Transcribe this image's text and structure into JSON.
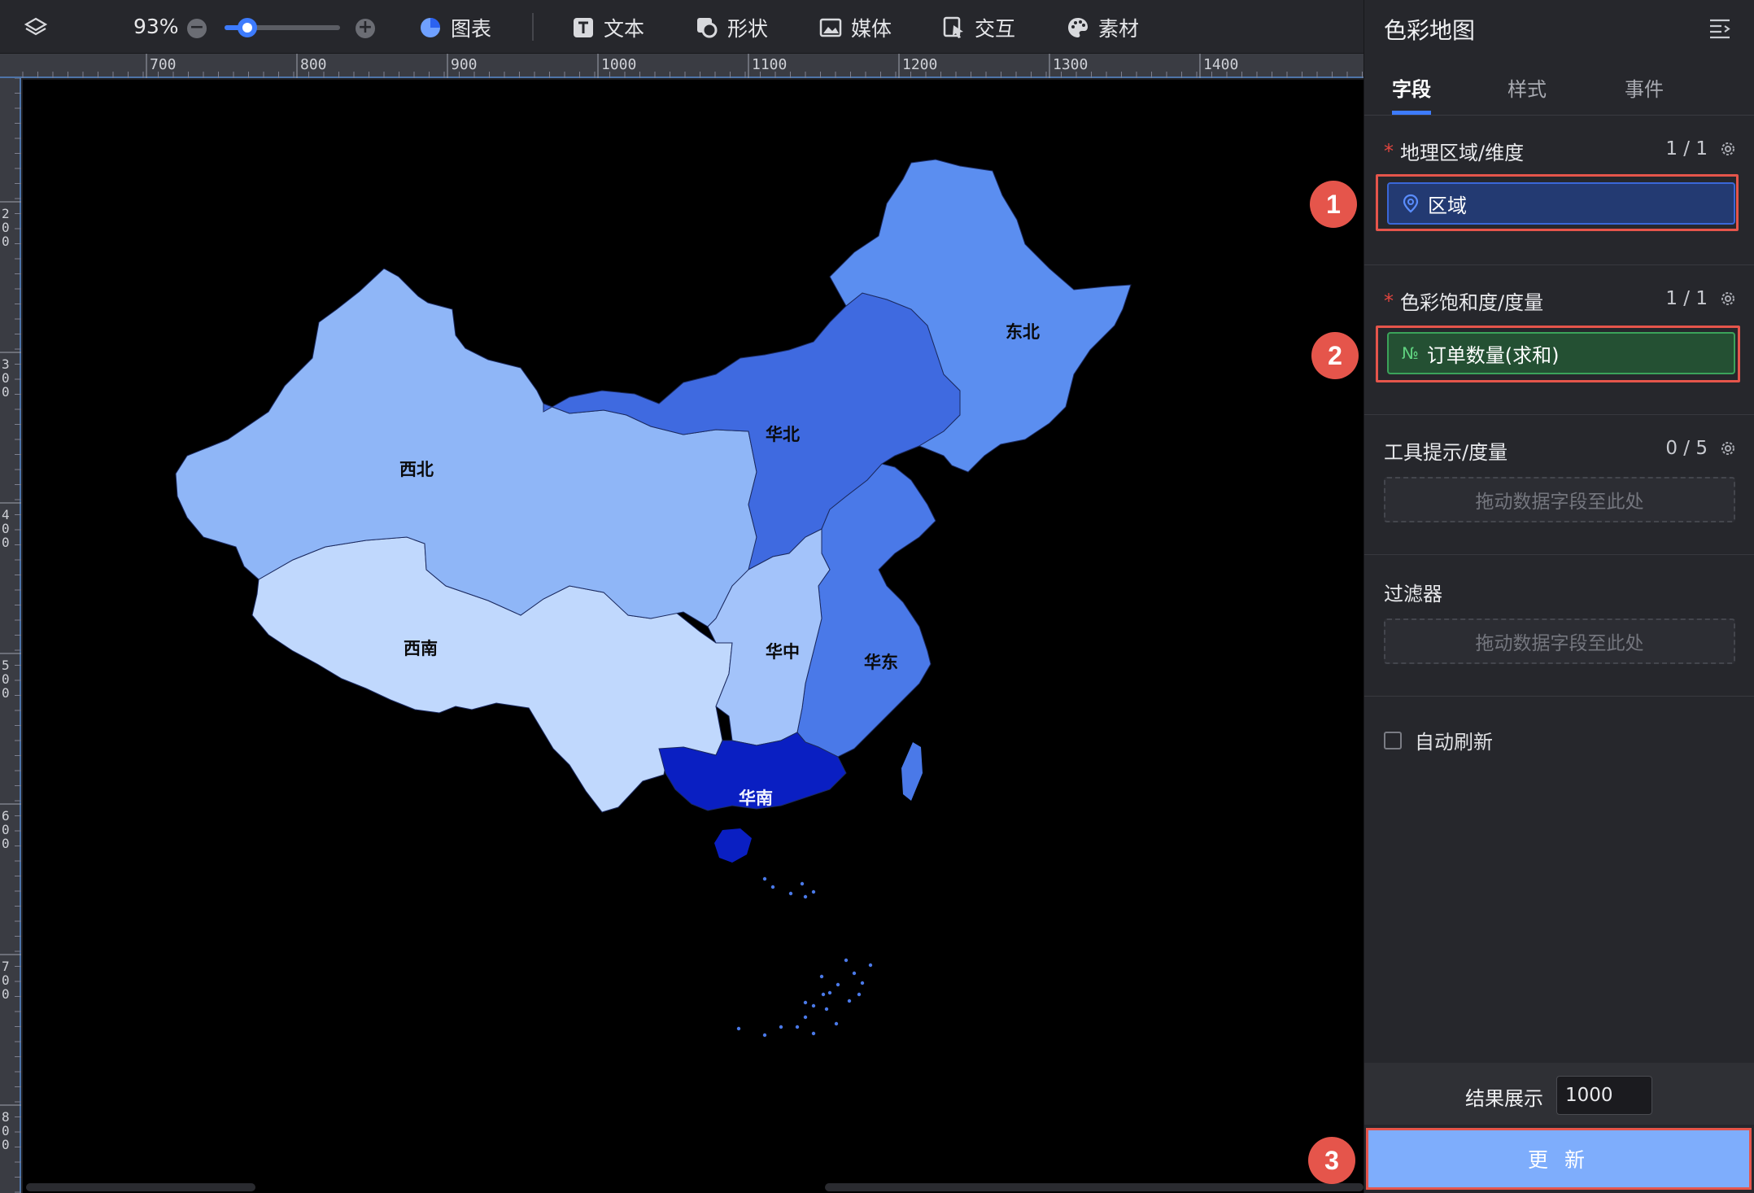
{
  "toolbar": {
    "zoom": "93%",
    "zoom_fraction": 0.2,
    "items": [
      {
        "label": "图表",
        "icon": "pie-chart-icon"
      },
      {
        "label": "文本",
        "icon": "text-icon"
      },
      {
        "label": "形状",
        "icon": "shape-icon"
      },
      {
        "label": "媒体",
        "icon": "image-icon"
      },
      {
        "label": "交互",
        "icon": "interaction-icon"
      },
      {
        "label": "素材",
        "icon": "palette-icon"
      }
    ]
  },
  "ruler": {
    "top_labels": [
      "700",
      "800",
      "900",
      "1000",
      "1100",
      "1200",
      "1300",
      "1400"
    ],
    "left_labels": [
      "200",
      "300",
      "400",
      "500",
      "600",
      "700",
      "800"
    ]
  },
  "map": {
    "regions": [
      {
        "name": "东北",
        "color": "#5b8ef0"
      },
      {
        "name": "华北",
        "color": "#3f6ae0"
      },
      {
        "name": "西北",
        "color": "#8fb6f7"
      },
      {
        "name": "西南",
        "color": "#c0d8fd"
      },
      {
        "name": "华中",
        "color": "#a3c3fa"
      },
      {
        "name": "华东",
        "color": "#4a79e8"
      },
      {
        "name": "华南",
        "color": "#0a1fc2"
      }
    ]
  },
  "panel": {
    "title": "色彩地图",
    "tabs": [
      "字段",
      "样式",
      "事件"
    ],
    "active_tab": "字段",
    "geo": {
      "label": "地理区域/维度",
      "count": "1 / 1",
      "field": "区域"
    },
    "color_measure": {
      "label": "色彩饱和度/度量",
      "count": "1 / 1",
      "field_prefix": "№",
      "field": "订单数量(求和)"
    },
    "tooltip": {
      "label": "工具提示/度量",
      "count": "0 / 5",
      "placeholder": "拖动数据字段至此处"
    },
    "filter": {
      "label": "过滤器",
      "placeholder": "拖动数据字段至此处"
    },
    "auto_refresh": {
      "label": "自动刷新",
      "checked": false
    },
    "result": {
      "label": "结果展示",
      "value": "1000"
    },
    "update_button": "更 新"
  },
  "badges": [
    "1",
    "2",
    "3"
  ]
}
